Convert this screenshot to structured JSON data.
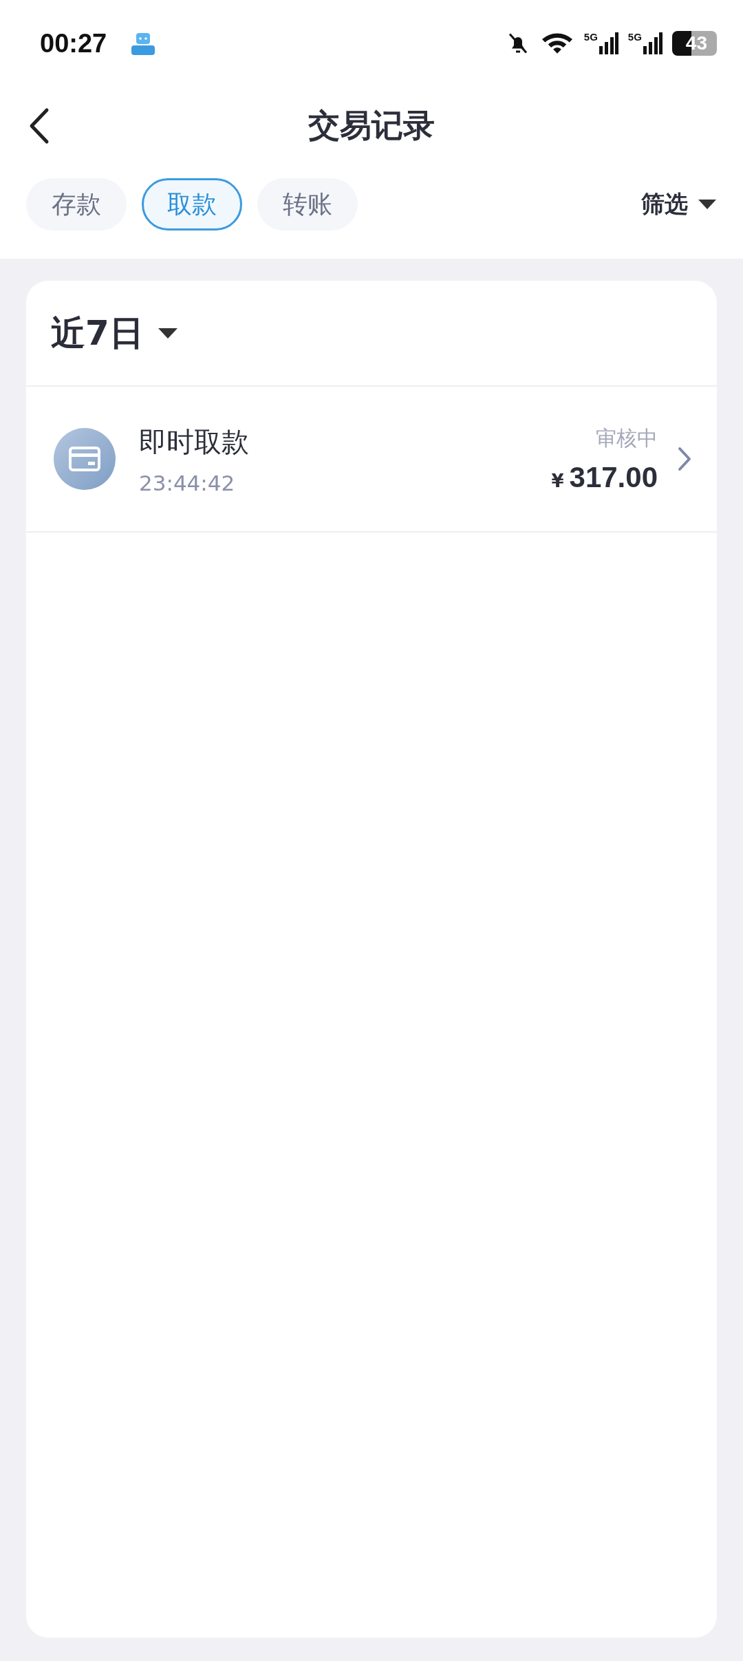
{
  "status_bar": {
    "time": "00:27",
    "signals": [
      {
        "label": "5G"
      },
      {
        "label": "5G"
      }
    ],
    "battery": "43"
  },
  "header": {
    "title": "交易记录"
  },
  "tabs": [
    {
      "label": "存款",
      "selected": false
    },
    {
      "label": "取款",
      "selected": true
    },
    {
      "label": "转账",
      "selected": false
    }
  ],
  "filter": {
    "label": "筛选"
  },
  "period": {
    "label": "近7日"
  },
  "transactions": [
    {
      "title": "即时取款",
      "time": "23:44:42",
      "status": "审核中",
      "currency": "¥",
      "amount": "317.00"
    }
  ]
}
